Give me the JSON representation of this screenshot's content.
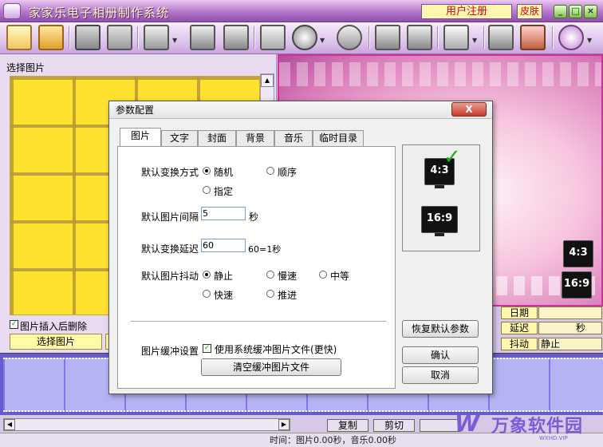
{
  "window": {
    "title": "家家乐电子相册制作系统",
    "register_label": "用户注册",
    "skin_label": "皮肤",
    "min": "_",
    "max": "□",
    "close": "×"
  },
  "toolbar": {
    "icons": [
      "new-album",
      "open-photos",
      "save",
      "save-as",
      "export-dropdown",
      "batch",
      "delete",
      "edit-picture",
      "effects-dropdown",
      "music",
      "wizard",
      "settings",
      "screen-dropdown",
      "print",
      "paint",
      "help-dropdown"
    ]
  },
  "left_panel": {
    "header": "选择图片",
    "delete_after_insert_label": "图片插入后删除",
    "delete_after_insert_checked": true,
    "select_button": "选择图片"
  },
  "info_panel": {
    "date_label": "日期",
    "date_value": "",
    "delay_label": "延迟",
    "delay_unit": "秒",
    "shake_label": "抖动",
    "shake_value": "静止"
  },
  "bottom": {
    "copy": "复制",
    "cut": "剪切",
    "status": "时间：图片0.00秒，音乐0.00秒"
  },
  "preview": {
    "ratio_43": "4:3",
    "ratio_169": "16:9"
  },
  "watermark": {
    "logo": "W",
    "brand": "万象软件园",
    "url": "WXHD.VIP"
  },
  "dialog": {
    "title": "参数配置",
    "close": "X",
    "tabs": [
      "图片",
      "文字",
      "封面",
      "背景",
      "音乐",
      "临时目录"
    ],
    "active_tab": "图片",
    "transition_label": "默认变换方式",
    "transition_options": [
      "随机",
      "顺序",
      "指定"
    ],
    "transition_selected": "随机",
    "interval_label": "默认图片间隔",
    "interval_value": "5",
    "interval_unit": "秒",
    "delay_label": "默认变换延迟",
    "delay_value": "60",
    "delay_note": "60=1秒",
    "shake_label": "默认图片抖动",
    "shake_options": [
      "静止",
      "慢速",
      "中等",
      "快速",
      "推进"
    ],
    "shake_selected": "静止",
    "cache_label": "图片缓冲设置",
    "cache_checkbox_label": "使用系统缓冲图片文件(更快)",
    "cache_checked": true,
    "clear_cache_button": "清空缓冲图片文件",
    "restore_defaults_button": "恢复默认参数",
    "ok_button": "确认",
    "cancel_button": "取消",
    "ratio_43": "4:3",
    "ratio_169": "16:9",
    "check": "✓"
  }
}
